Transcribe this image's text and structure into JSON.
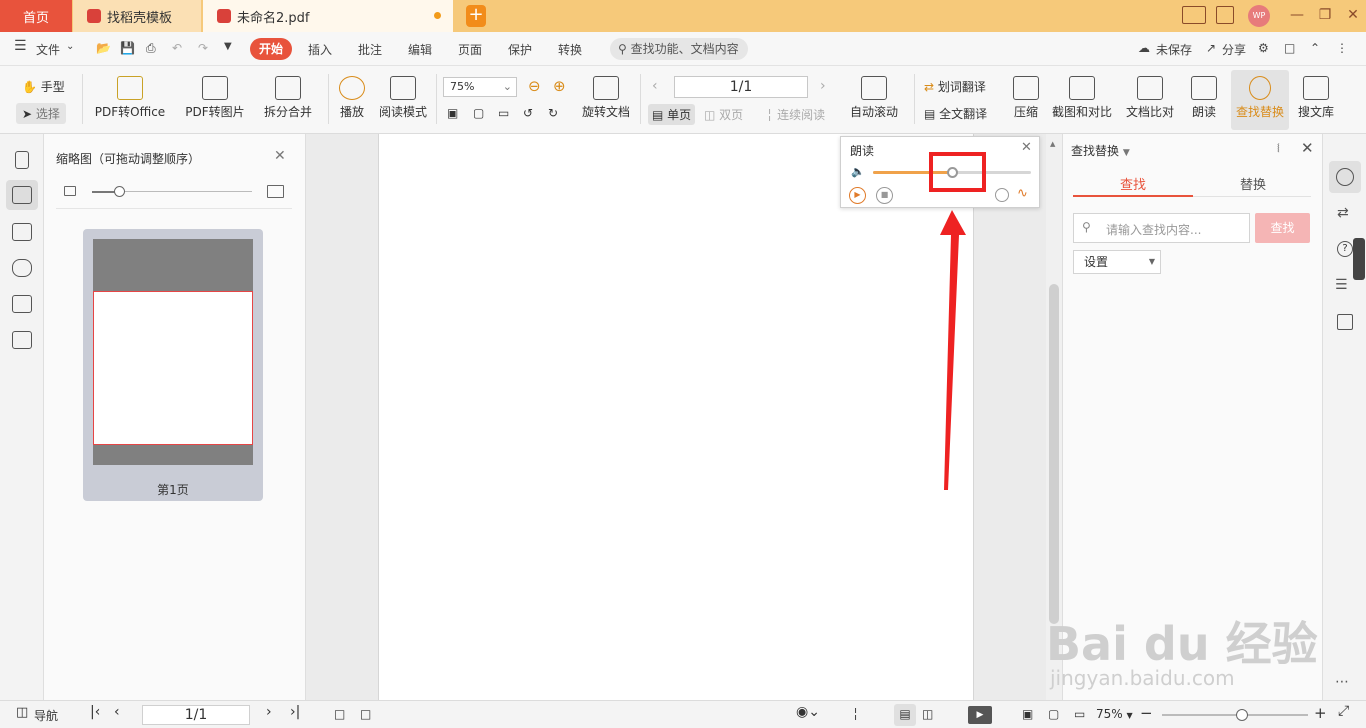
{
  "titlebar": {
    "tabs": [
      {
        "label": "首页"
      },
      {
        "label": "找稻壳模板"
      },
      {
        "label": "未命名2.pdf"
      }
    ],
    "new_tab": "+",
    "avatar": "WP",
    "colors": {
      "active_tab": "#e8533c",
      "title_bg": "#f6c97a"
    }
  },
  "menubar": {
    "file": "文件",
    "items": [
      "开始",
      "插入",
      "批注",
      "编辑",
      "页面",
      "保护",
      "转换"
    ],
    "search_placeholder": "查找功能、文档内容",
    "unsaved": "未保存",
    "share": "分享"
  },
  "ribbon": {
    "hand": "手型",
    "select": "选择",
    "pdf_to_office": "PDF转Office",
    "pdf_to_image": "PDF转图片",
    "split_merge": "拆分合并",
    "play": "播放",
    "read_mode": "阅读模式",
    "zoom": "75%",
    "rotate": "旋转文档",
    "page_value": "1/1",
    "single": "单页",
    "double": "双页",
    "continuous": "连续阅读",
    "auto_scroll": "自动滚动",
    "word_translate": "划词翻译",
    "full_translate": "全文翻译",
    "compress": "压缩",
    "screenshot_compare": "截图和对比",
    "doc_compare": "文档比对",
    "read_aloud": "朗读",
    "find_replace": "查找替换",
    "library": "搜文库"
  },
  "thumbnails": {
    "title": "缩略图（可拖动调整顺序）",
    "page_label": "第1页"
  },
  "reader_popup": {
    "title": "朗读",
    "volume": 0.5
  },
  "find_panel": {
    "title": "查找替换",
    "tab_find": "查找",
    "tab_replace": "替换",
    "placeholder": "请输入查找内容...",
    "find_button": "查找",
    "settings": "设置"
  },
  "statusbar": {
    "nav": "导航",
    "page": "1/1",
    "zoom": "75%",
    "zoom_level": 0.55
  },
  "watermark": {
    "brand": "Bai du 经验",
    "url": "jingyan.baidu.com"
  }
}
